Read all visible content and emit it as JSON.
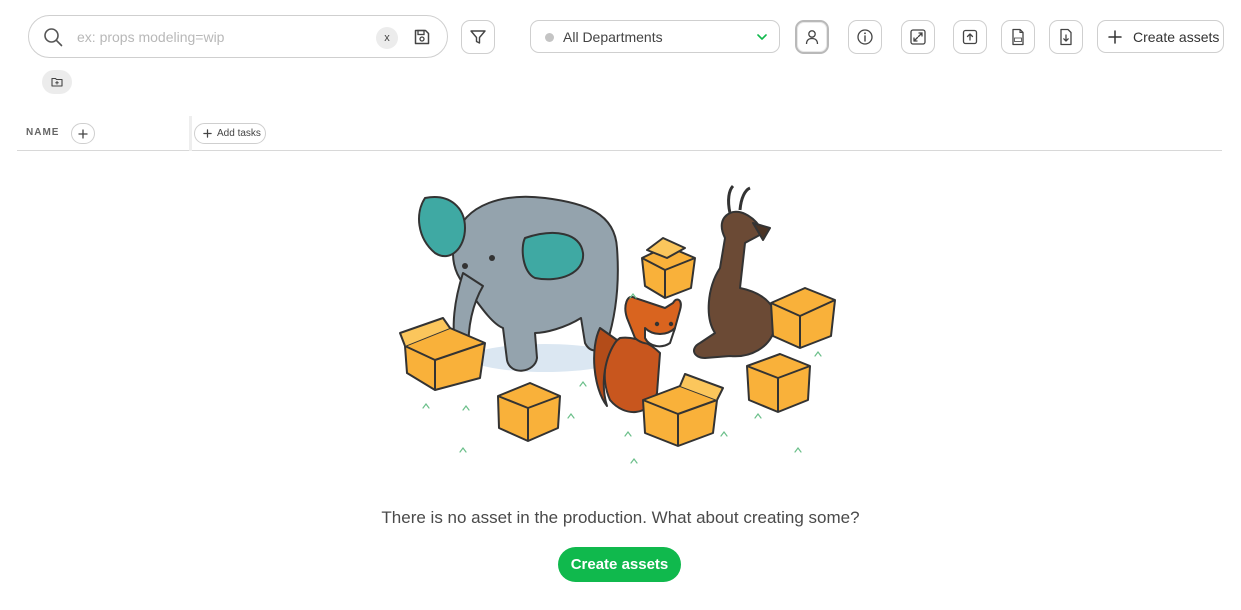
{
  "search": {
    "placeholder": "ex: props modeling=wip",
    "value": "",
    "clear_label": "x"
  },
  "department_filter": {
    "selected": "All Departments"
  },
  "toolbar": {
    "create_label": "Create assets"
  },
  "table": {
    "name_header": "NAME",
    "add_tasks_label": "Add tasks"
  },
  "empty_state": {
    "message": "There is no asset in the production. What about creating some?",
    "button_label": "Create assets"
  },
  "colors": {
    "primary_green": "#10b94d",
    "box_orange": "#f9b13a",
    "elephant_gray": "#94a3ad",
    "ear_teal": "#3fa9a3"
  }
}
